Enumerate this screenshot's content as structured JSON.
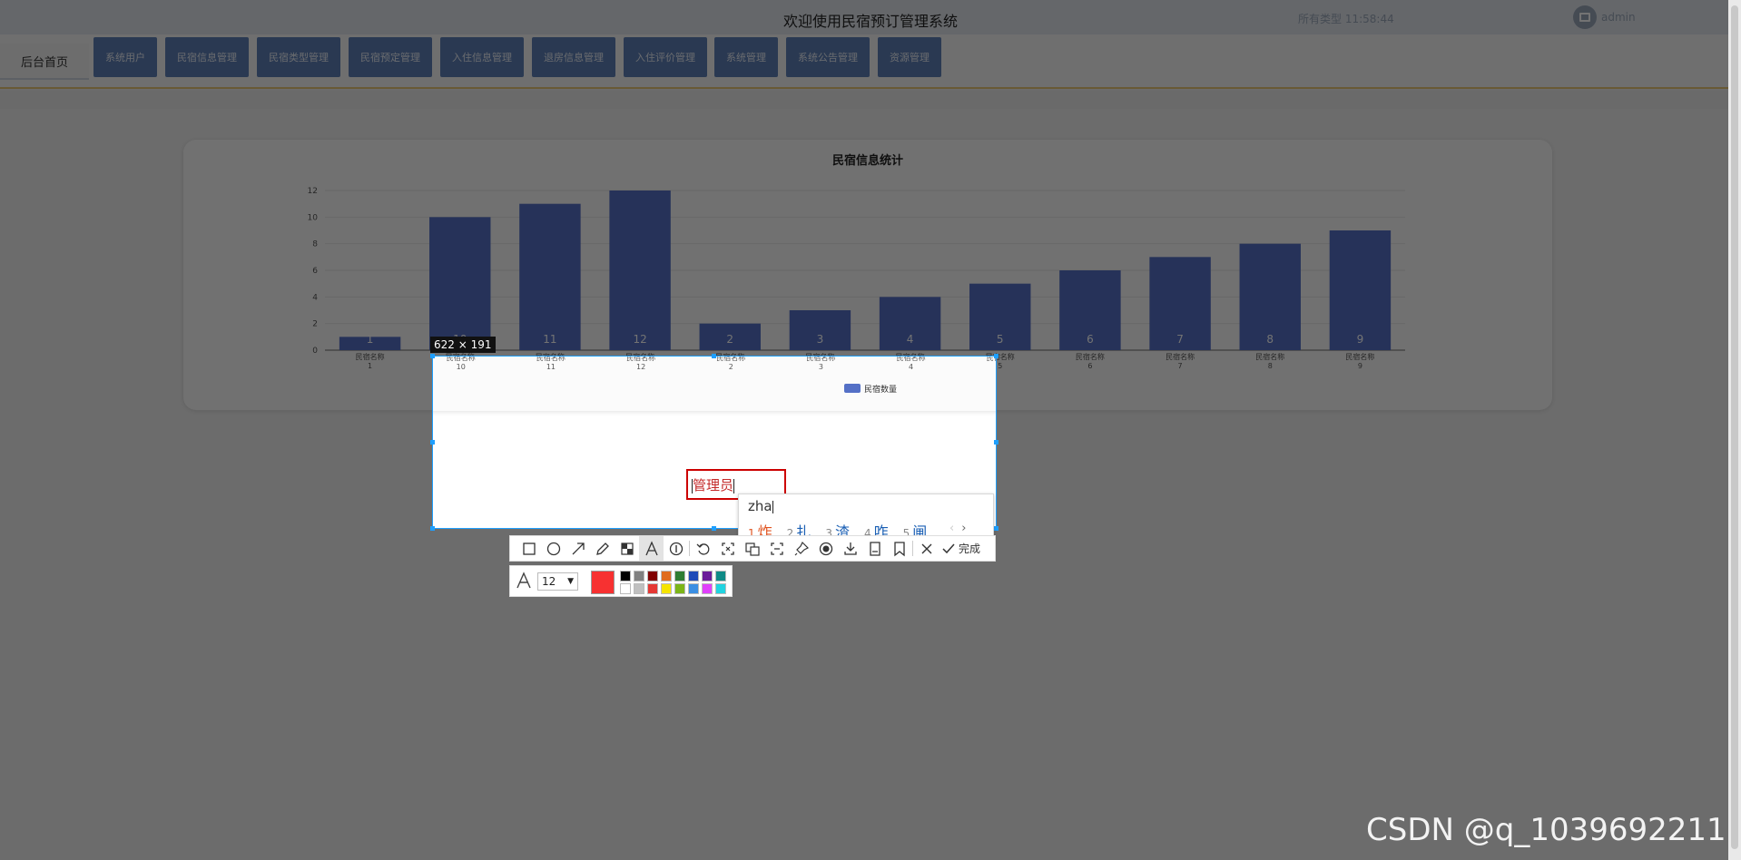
{
  "app": {
    "title": "欢迎使用民宿预订管理系统",
    "top_info": "所有类型 11:58:44",
    "user_name": "admin"
  },
  "nav": {
    "home_label": "后台首页",
    "items": [
      {
        "label": "系统用户"
      },
      {
        "label": "民宿信息管理"
      },
      {
        "label": "民宿类型管理"
      },
      {
        "label": "民宿预定管理"
      },
      {
        "label": "入住信息管理"
      },
      {
        "label": "退房信息管理"
      },
      {
        "label": "入住评价管理"
      },
      {
        "label": "系统管理"
      },
      {
        "label": "系统公告管理"
      },
      {
        "label": "资源管理"
      }
    ]
  },
  "chart_data": {
    "type": "bar",
    "title": "民宿信息统计",
    "categories": [
      "民宿名称\n1",
      "民宿名称\n10",
      "民宿名称\n11",
      "民宿名称\n12",
      "民宿名称\n2",
      "民宿名称\n3",
      "民宿名称\n4",
      "民宿名称\n5",
      "民宿名称\n6",
      "民宿名称\n7",
      "民宿名称\n8",
      "民宿名称\n9"
    ],
    "series": [
      {
        "name": "民宿数量",
        "values": [
          1,
          10,
          11,
          12,
          2,
          3,
          4,
          5,
          6,
          7,
          8,
          9
        ]
      }
    ],
    "ylim": [
      0,
      12
    ],
    "yticks": [
      0,
      2,
      4,
      6,
      8,
      10,
      12
    ],
    "grid": true,
    "legend": "bottom-center",
    "bar_color": "#5470c6"
  },
  "capture": {
    "size_label": "622 × 191",
    "text_value": "管理员"
  },
  "ime": {
    "composition": "zha",
    "candidates": [
      {
        "num": "1",
        "text": "炸"
      },
      {
        "num": "2",
        "text": "扎"
      },
      {
        "num": "3",
        "text": "渣"
      },
      {
        "num": "4",
        "text": "咋"
      },
      {
        "num": "5",
        "text": "闸"
      }
    ],
    "prev": "‹",
    "next": "›"
  },
  "toolbar": {
    "tools": [
      "rectangle-icon",
      "ellipse-icon",
      "arrow-icon",
      "pencil-icon",
      "mosaic-icon",
      "text-icon",
      "number-icon",
      "undo-icon",
      "ocr-icon",
      "translate-icon",
      "extract-icon",
      "pin-icon",
      "record-icon",
      "download-icon",
      "save-icon",
      "bookmark-icon",
      "close-icon",
      "check-icon"
    ],
    "done_label": "完成"
  },
  "style": {
    "font_size": "12",
    "current_color": "#f73131",
    "palette": [
      "#000000",
      "#808080",
      "#800000",
      "#e06c1e",
      "#2e7d32",
      "#1f4bb8",
      "#6a1b9a",
      "#0f8a86",
      "#ffffff",
      "#c0c0c0",
      "#e53935",
      "#f5e400",
      "#7cb518",
      "#3b8fe3",
      "#e040fb",
      "#22d3e0"
    ]
  },
  "watermark": "CSDN @q_1039692211"
}
